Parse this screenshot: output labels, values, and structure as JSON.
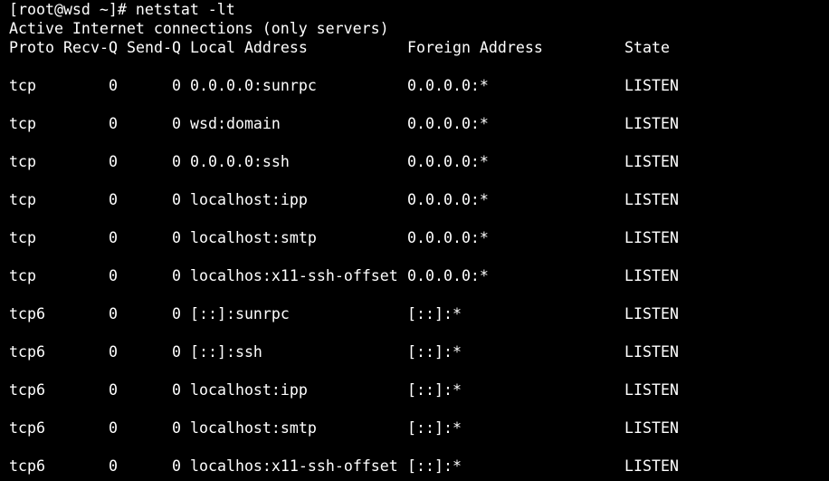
{
  "terminal": {
    "prompt": "[root@wsd ~]# ",
    "command": "netstat -lt",
    "header": "Active Internet connections (only servers)",
    "colors": {
      "background": "#000000",
      "foreground": "#ffffff"
    }
  },
  "table": {
    "columns": [
      "Proto",
      "Recv-Q",
      "Send-Q",
      "Local Address",
      "Foreign Address",
      "State"
    ],
    "rows": [
      [
        "tcp",
        "0",
        "0",
        "0.0.0.0:sunrpc",
        "0.0.0.0:*",
        "LISTEN"
      ],
      [
        "tcp",
        "0",
        "0",
        "wsd:domain",
        "0.0.0.0:*",
        "LISTEN"
      ],
      [
        "tcp",
        "0",
        "0",
        "0.0.0.0:ssh",
        "0.0.0.0:*",
        "LISTEN"
      ],
      [
        "tcp",
        "0",
        "0",
        "localhost:ipp",
        "0.0.0.0:*",
        "LISTEN"
      ],
      [
        "tcp",
        "0",
        "0",
        "localhost:smtp",
        "0.0.0.0:*",
        "LISTEN"
      ],
      [
        "tcp",
        "0",
        "0",
        "localhos:x11-ssh-offset",
        "0.0.0.0:*",
        "LISTEN"
      ],
      [
        "tcp6",
        "0",
        "0",
        "[::]:sunrpc",
        "[::]:*",
        "LISTEN"
      ],
      [
        "tcp6",
        "0",
        "0",
        "[::]:ssh",
        "[::]:*",
        "LISTEN"
      ],
      [
        "tcp6",
        "0",
        "0",
        "localhost:ipp",
        "[::]:*",
        "LISTEN"
      ],
      [
        "tcp6",
        "0",
        "0",
        "localhost:smtp",
        "[::]:*",
        "LISTEN"
      ],
      [
        "tcp6",
        "0",
        "0",
        "localhos:x11-ssh-offset",
        "[::]:*",
        "LISTEN"
      ]
    ]
  }
}
